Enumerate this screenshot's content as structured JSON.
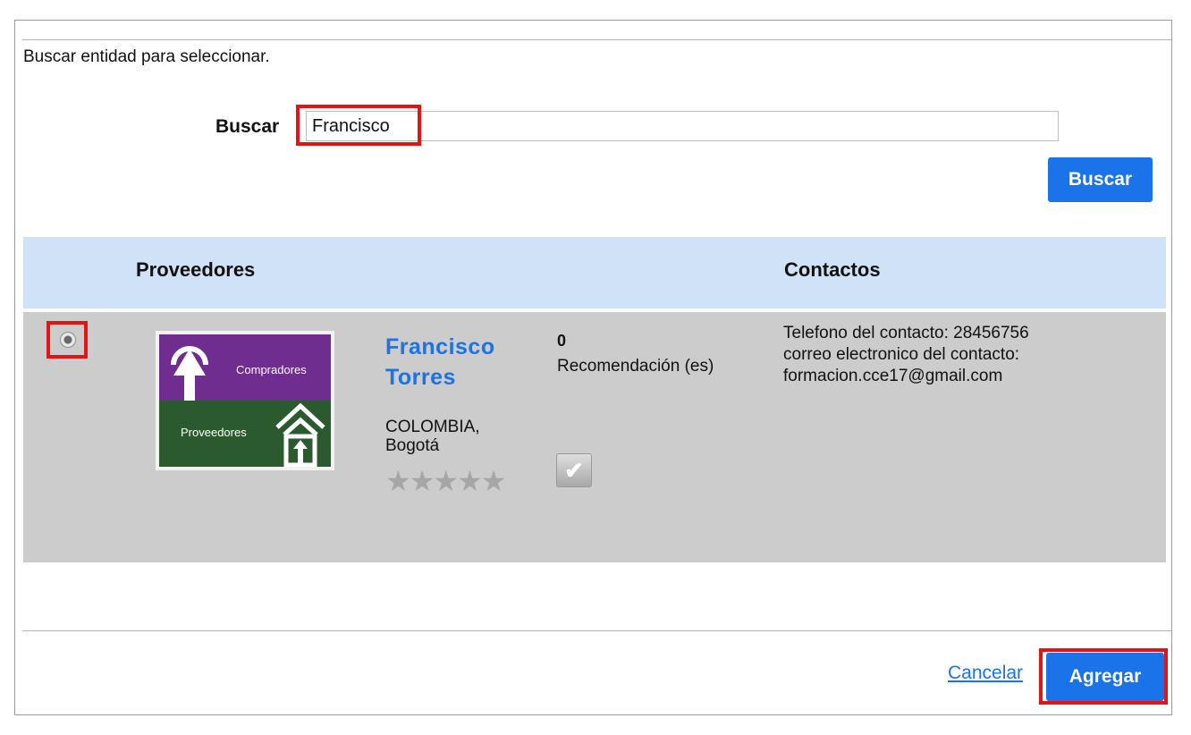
{
  "dialog": {
    "intro": "Buscar entidad para seleccionar.",
    "search": {
      "label": "Buscar",
      "value": "Francisco",
      "button_label": "Buscar"
    },
    "table": {
      "headers": [
        "Proveedores",
        "Contactos"
      ],
      "row": {
        "logo_top_text": "Compradores",
        "logo_bottom_text": "Proveedores",
        "name_line1": "Francisco",
        "name_line2": "Torres",
        "location": "COLOMBIA, Bogotá",
        "stars": "★★★★★",
        "recommendation_count": "0",
        "recommendation_label": "Recomendación (es)",
        "contact_phone": "Telefono del contacto: 28456756",
        "contact_email_label": "correo electronico del contacto:",
        "contact_email": "formacion.cce17@gmail.com"
      }
    },
    "footer": {
      "cancel_label": "Cancelar",
      "add_label": "Agregar"
    }
  },
  "colors": {
    "accent": "#1a73e8",
    "highlight": "#e01616",
    "header_bg": "#cfe2f7",
    "row_bg": "#cccccc"
  }
}
